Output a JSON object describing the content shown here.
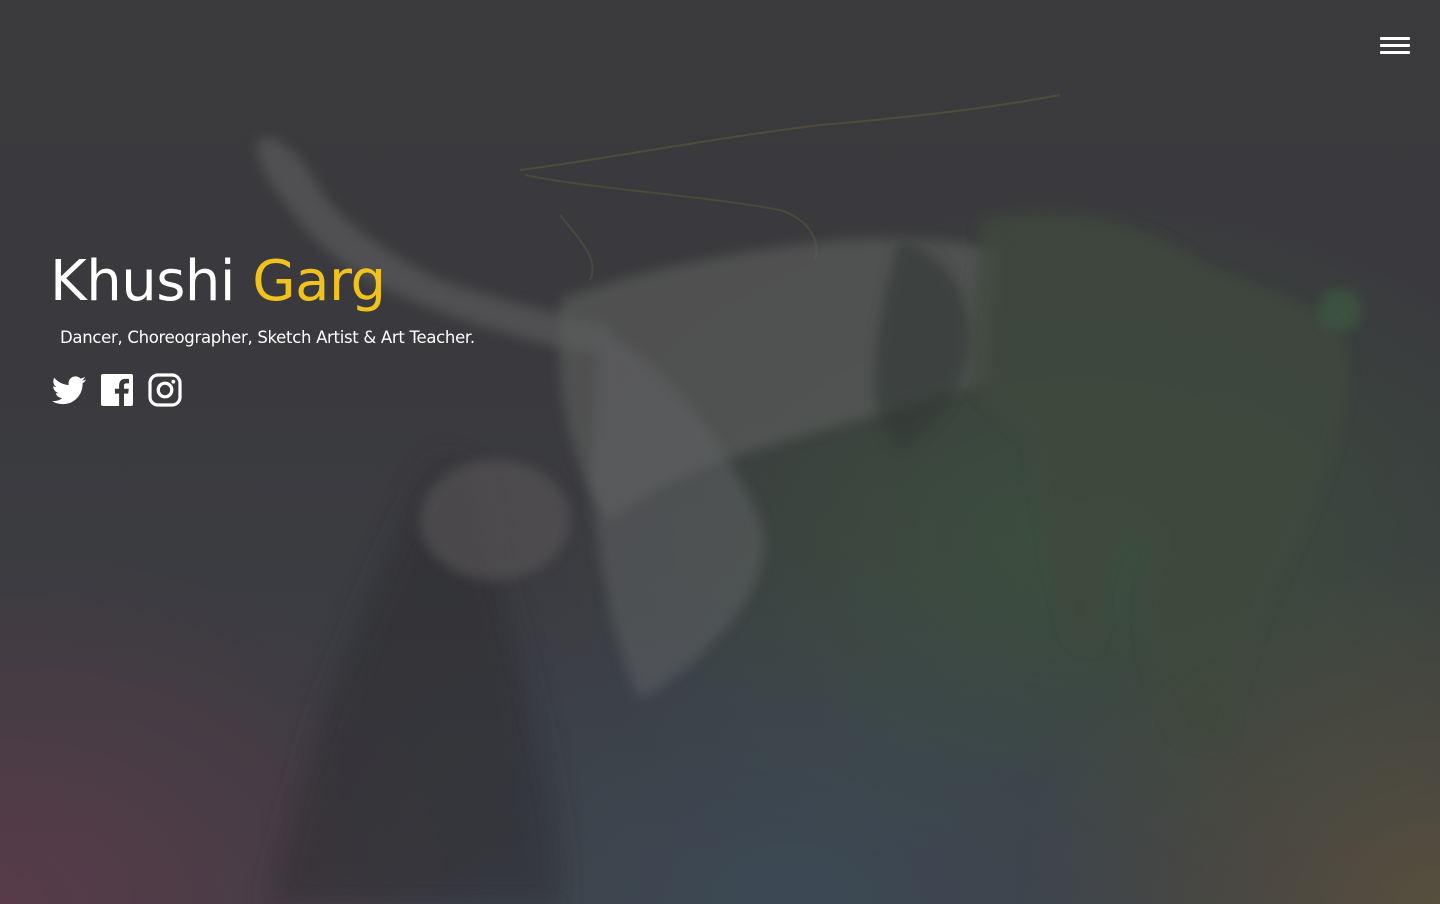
{
  "header": {
    "menu_icon": "hamburger-menu-icon"
  },
  "hero": {
    "first_name": "Khushi",
    "last_name": "Garg",
    "tagline": "Dancer, Choreographer, Sketch Artist & Art Teacher.",
    "accent_color": "#f2c21c",
    "socials": [
      {
        "name": "twitter",
        "icon": "twitter-icon"
      },
      {
        "name": "facebook",
        "icon": "facebook-icon"
      },
      {
        "name": "instagram",
        "icon": "instagram-icon"
      }
    ]
  }
}
